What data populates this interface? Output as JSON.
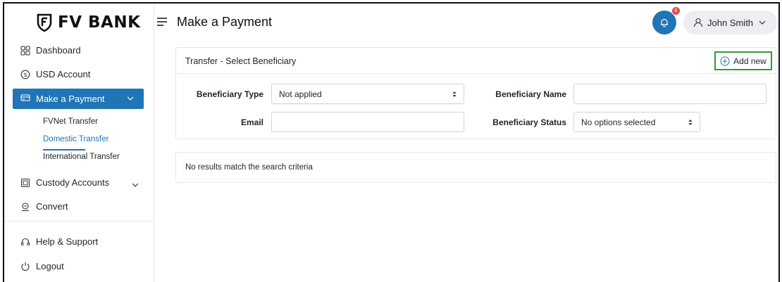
{
  "brand": {
    "name": "FV BANK"
  },
  "sidebar": {
    "items": [
      {
        "label": "Dashboard",
        "icon": "dashboard-grid-icon"
      },
      {
        "label": "USD Account",
        "icon": "dollar-circle-icon"
      },
      {
        "label": "Make a Payment",
        "icon": "payment-icon",
        "active": true
      },
      {
        "label": "Custody Accounts",
        "icon": "custody-icon"
      },
      {
        "label": "Convert",
        "icon": "convert-icon"
      },
      {
        "label": "Help & Support",
        "icon": "headset-icon"
      },
      {
        "label": "Logout",
        "icon": "power-icon"
      }
    ],
    "subitems": [
      {
        "label": "FVNet Transfer"
      },
      {
        "label": "Domestic Transfer",
        "active": true
      },
      {
        "label": "International Transfer"
      }
    ]
  },
  "header": {
    "title": "Make a Payment",
    "notifications_count": "6",
    "user_name": "John Smith"
  },
  "beneficiary_panel": {
    "title": "Transfer - Select Beneficiary",
    "add_new_label": "Add new",
    "type_label": "Beneficiary Type",
    "type_value": "Not applied",
    "name_label": "Beneficiary Name",
    "name_value": "",
    "email_label": "Email",
    "email_value": "",
    "status_label": "Beneficiary Status",
    "status_value": "No options selected"
  },
  "results": {
    "message": "No results match the search criteria"
  },
  "colors": {
    "accent": "#1f75b5",
    "badge": "#e5484d",
    "highlight_border": "#2e9c3a"
  }
}
